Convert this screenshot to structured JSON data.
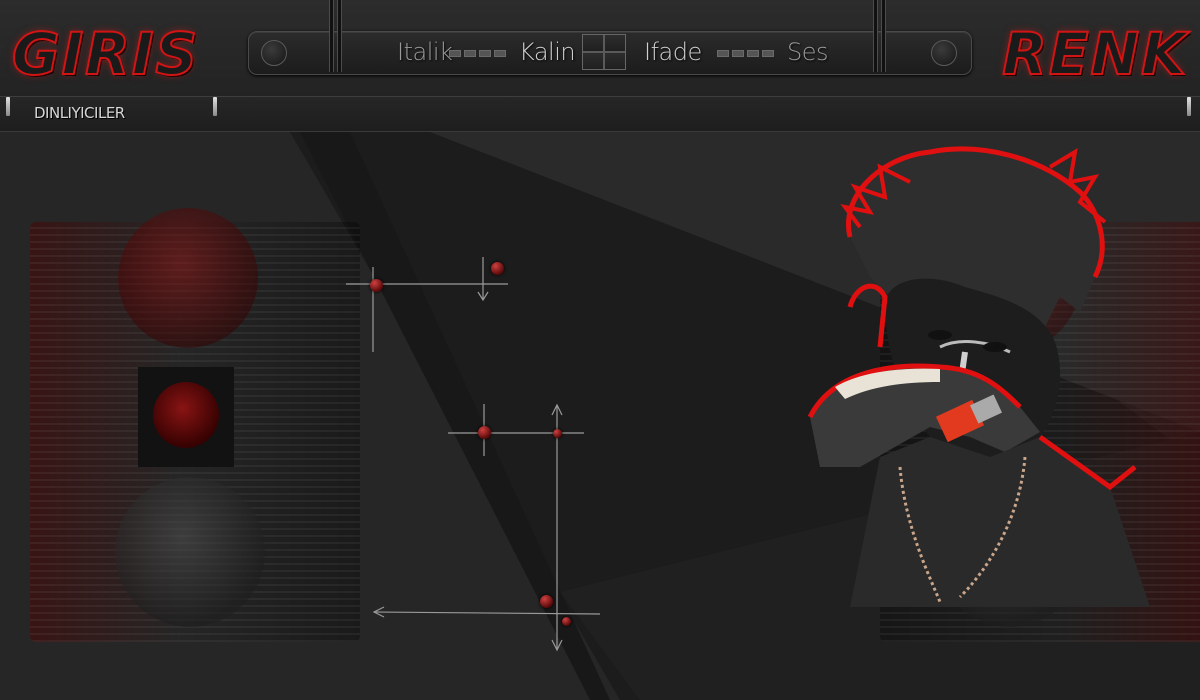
{
  "header": {
    "left_logo": "GIRIS",
    "right_logo": "RENK",
    "toolbar": {
      "italic": "Italik",
      "bold": "Kalin",
      "emote": "Ifade",
      "sound": "Ses"
    }
  },
  "subbar": {
    "tab_label": "DINLIYICILER"
  },
  "colors": {
    "accent_red": "#d11414",
    "bar_dark": "#232323",
    "text_light": "#cfcfcf"
  }
}
